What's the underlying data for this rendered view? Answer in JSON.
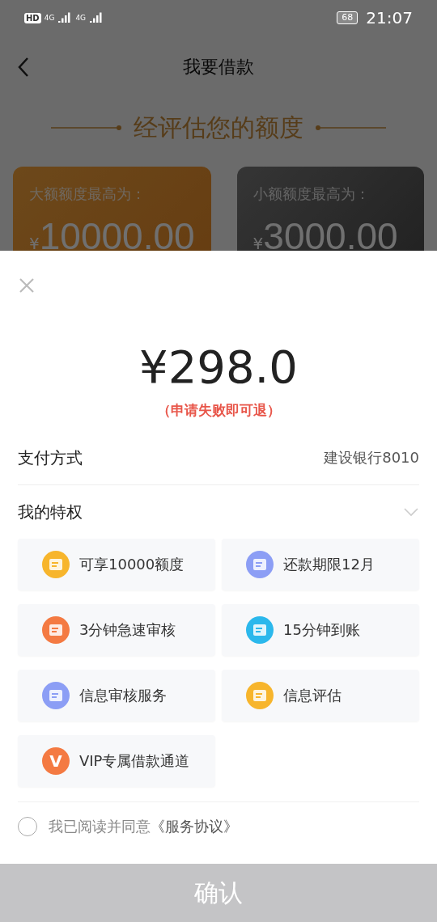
{
  "status_bar": {
    "hd_badge": "HD",
    "network_1": "4G",
    "network_2": "4G",
    "battery": "68",
    "time": "21:07"
  },
  "nav": {
    "title": "我要借款"
  },
  "heading": "经评估您的额度",
  "limit_cards": [
    {
      "kind": "large",
      "label": "大额额度最高为：",
      "currency": "¥",
      "amount": "10000.00"
    },
    {
      "kind": "small",
      "label": "小额额度最高为：",
      "currency": "¥",
      "amount": "3000.00"
    }
  ],
  "sheet": {
    "price": "¥298.0",
    "refund_note": "（申请失败即可退）",
    "payment": {
      "label": "支付方式",
      "value": "建设银行8010"
    },
    "privileges": {
      "title": "我的特权",
      "expanded": true,
      "items": [
        {
          "label": "可享10000额度",
          "color": "#f7b52c"
        },
        {
          "label": "还款期限12月",
          "color": "#8c9ef5"
        },
        {
          "label": "3分钟急速审核",
          "color": "#f47a42"
        },
        {
          "label": "15分钟到账",
          "color": "#2bb8ec"
        },
        {
          "label": "信息审核服务",
          "color": "#8c9ef5"
        },
        {
          "label": "信息评估",
          "color": "#f7b52c"
        },
        {
          "label": "VIP专属借款通道",
          "color": "#f47a42",
          "icon_text": "V"
        }
      ]
    },
    "agreement": {
      "checked": false,
      "text": "我已阅读并同意",
      "link": "《服务协议》"
    },
    "confirm": {
      "label": "确认",
      "disabled": true
    }
  }
}
